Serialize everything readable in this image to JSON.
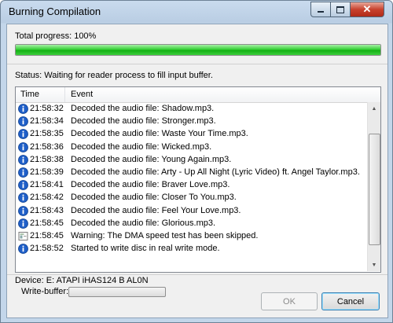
{
  "window": {
    "title": "Burning Compilation"
  },
  "progress": {
    "label": "Total progress: 100%",
    "value": 100
  },
  "status": {
    "text": "Status: Waiting for reader process to fill input buffer."
  },
  "log": {
    "columns": [
      "Time",
      "Event"
    ],
    "rows": [
      {
        "icon": "info-icon",
        "time": "21:58:32",
        "event": "Decoded the audio file: Shadow.mp3."
      },
      {
        "icon": "info-icon",
        "time": "21:58:34",
        "event": "Decoded the audio file: Stronger.mp3."
      },
      {
        "icon": "info-icon",
        "time": "21:58:35",
        "event": "Decoded the audio file: Waste Your Time.mp3."
      },
      {
        "icon": "info-icon",
        "time": "21:58:36",
        "event": "Decoded the audio file: Wicked.mp3."
      },
      {
        "icon": "info-icon",
        "time": "21:58:38",
        "event": "Decoded the audio file: Young Again.mp3."
      },
      {
        "icon": "info-icon",
        "time": "21:58:39",
        "event": "Decoded the audio file: Arty - Up All Night (Lyric Video) ft. Angel Taylor.mp3."
      },
      {
        "icon": "info-icon",
        "time": "21:58:41",
        "event": "Decoded the audio file: Braver Love.mp3."
      },
      {
        "icon": "info-icon",
        "time": "21:58:42",
        "event": "Decoded the audio file: Closer To You.mp3."
      },
      {
        "icon": "info-icon",
        "time": "21:58:43",
        "event": "Decoded the audio file: Feel Your Love.mp3."
      },
      {
        "icon": "info-icon",
        "time": "21:58:45",
        "event": "Decoded the audio file: Glorious.mp3."
      },
      {
        "icon": "warning-icon",
        "time": "21:58:45",
        "event": "Warning: The DMA speed test has been skipped."
      },
      {
        "icon": "info-icon",
        "time": "21:58:52",
        "event": "Started to write disc in real write mode."
      }
    ]
  },
  "device": {
    "label": "Device: E: ATAPI iHAS124   B AL0N"
  },
  "write_buffer": {
    "label": "Write-buffer:",
    "value": 0
  },
  "buttons": {
    "ok": "OK",
    "cancel": "Cancel"
  },
  "colors": {
    "progress_fill": "#22c322",
    "info_icon": "#1f5fc8",
    "accent": "#3c7fb1"
  }
}
